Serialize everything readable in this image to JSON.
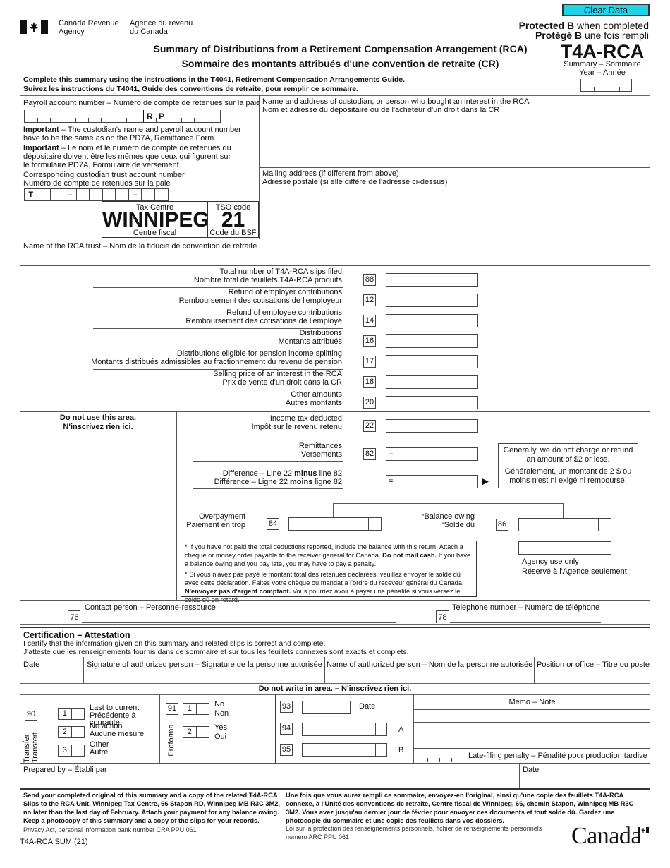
{
  "header": {
    "clear_button": "Clear Data",
    "agency_en_1": "Canada Revenue",
    "agency_en_2": "Agency",
    "agency_fr_1": "Agence du revenu",
    "agency_fr_2": "du Canada",
    "protected_en_bold": "Protected B",
    "protected_en_rest": " when completed",
    "protected_fr_bold": "Protégé B",
    "protected_fr_rest": " une fois rempli",
    "title_en": "Summary of Distributions from a Retirement Compensation Arrangement (RCA)",
    "title_fr": "Sommaire des montants attribués d'une convention de retraite (CR)",
    "form_code": "T4A-RCA",
    "summary_label": "Summary – Sommaire",
    "year_label": "Year – Année",
    "instructions_en": "Complete this summary using the instructions in the T4041, Retirement Compensation Arrangements Guide.",
    "instructions_fr": "Suivez les instructions du T4041, Guide des conventions de retraite, pour remplir ce sommaire."
  },
  "left_panel": {
    "payroll_label": "Payroll account number – Numéro de compte de retenues sur la paie",
    "rp_r": "R",
    "rp_p": "P",
    "important_en_bold": "Important",
    "important_en": " – The custodian's name and payroll account number have to be the same as on the PD7A, Remittance Form.",
    "important_fr_bold": "Important",
    "important_fr": " – Le nom et le numéro de compte de retenues du dépositaire doivent être les mêmes que ceux qui figurent sur le formulaire PD7A, Formulaire de versement.",
    "trust_account_en": "Corresponding custodian trust account number",
    "trust_account_fr": "Numéro de compte de retenues sur la paie",
    "trust_prefix": "T",
    "dash": "–",
    "tax_centre_label": "Tax Centre",
    "tax_centre_value": "WINNIPEG",
    "tax_centre_fr": "Centre fiscal",
    "tso_label": "TSO code",
    "tso_value": "21",
    "tso_fr": "Code du BSF"
  },
  "right_panel": {
    "custodian_en": "Name and address of custodian, or person who bought an interest in the RCA",
    "custodian_fr": "Nom et adresse du dépositaire ou de l'acheteur d'un droit dans la CR",
    "mailing_en": "Mailing address (if different from above)",
    "mailing_fr": "Adresse postale (si elle diffère de l'adresse ci-dessus)"
  },
  "trust_name_label": "Name of the RCA trust – Nom de la fiducie de convention de retraite",
  "lines": [
    {
      "code": "88",
      "en": "Total number of T4A-RCA slips filed",
      "fr": "Nombre total de feuillets T4A-RCA produits"
    },
    {
      "code": "12",
      "en": "Refund of employer contributions",
      "fr": "Remboursement des cotisations de l'employeur"
    },
    {
      "code": "14",
      "en": "Refund of employee contributions",
      "fr": "Remboursement des cotisations de l'employé"
    },
    {
      "code": "16",
      "en": "Distributions",
      "fr": "Montants attribués"
    },
    {
      "code": "17",
      "en": "Distributions eligible for pension income splitting",
      "fr": "Montants distribués admissibles au fractionnement du revenu de pension"
    },
    {
      "code": "18",
      "en": "Selling price of an interest in the RCA",
      "fr": "Prix de vente d'un droit dans la CR"
    },
    {
      "code": "20",
      "en": "Other amounts",
      "fr": "Autres montants"
    }
  ],
  "tax_section": {
    "do_not_use_en": "Do not use this area.",
    "do_not_use_fr": "N'inscrivez rien ici.",
    "income_tax_en": "Income tax deducted",
    "income_tax_fr": "Impôt sur le revenu retenu",
    "code_22": "22",
    "remittances_en": "Remittances",
    "remittances_fr": "Versements",
    "code_82": "82",
    "minus_sign": "–",
    "difference_en_1": "Difference – Line 22 ",
    "difference_en_b": "minus",
    "difference_en_2": " line 82",
    "difference_fr_1": "Différence – Ligne 22 ",
    "difference_fr_b": "moins",
    "difference_fr_2": " ligne 82",
    "equals_sign": "=",
    "arrow": "▶",
    "note_en": "Generally, we do not charge or refund an amount of $2 or less.",
    "note_fr": "Généralement, un montant de 2 $ ou moins n'est ni exigé ni remboursé.",
    "overpayment_en": "Overpayment",
    "overpayment_fr": "Paiement en trop",
    "code_84": "84",
    "asterisk": "*",
    "balance_en": "Balance owing",
    "balance_fr": "Solde dû",
    "code_86": "86",
    "notice_en_1": "* If you have not paid the total deductions reported, include the balance with this return. Attach a cheque or money order payable to the receiver general for Canada. ",
    "notice_en_b": "Do not mail cash.",
    "notice_en_2": " If you have a balance owing and you pay late, you may have to pay a penalty.",
    "notice_fr_1": "* Si vous n'avez pas payé le montant total des retenues déclarées, veuillez envoyer le solde dû avec cette déclaration. Faites votre chèque ou mandat à l'ordre du receveur général du Canada. ",
    "notice_fr_b": "N'envoyez pas d'argent comptant.",
    "notice_fr_2": " Vous pourriez avoir à payer une pénalité si vous versez le solde dû en retard.",
    "agency_use_en": "Agency use only",
    "agency_use_fr": "Réservé à l'Agence seulement",
    "blue": "#1a3fd6"
  },
  "contact": {
    "contact_code": "76",
    "contact_label": "Contact person – Personne-ressource",
    "phone_code": "78",
    "phone_label": "Telephone number – Numéro de téléphone"
  },
  "certification": {
    "title": "Certification – Attestation",
    "text_en": "I certify that the information given on this summary and related slips is correct and complete.",
    "text_fr": "J'atteste que les renseignements fournis dans ce sommaire et sur tous les feuillets connexes sont exacts et complets.",
    "date": "Date",
    "signature": "Signature of authorized person – Signature de la personne autorisée",
    "name": "Name of authorized person – Nom de la personne autorisée",
    "position": "Position or office – Titre ou poste"
  },
  "office_area": {
    "heading": "Do not write in area. – N'inscrivez rien ici.",
    "code_90": "90",
    "transfer_en": "Transfer",
    "transfer_fr": "Transfert",
    "options_90": [
      {
        "n": "1",
        "en": "Last to current",
        "fr": "Précédente à courante"
      },
      {
        "n": "2",
        "en": "No action",
        "fr": "Aucune mesure"
      },
      {
        "n": "3",
        "en": "Other",
        "fr": "Autre"
      }
    ],
    "code_91": "91",
    "proforma": "Proforma",
    "options_91": [
      {
        "n": "1",
        "en": "No",
        "fr": "Non"
      },
      {
        "n": "2",
        "en": "Yes",
        "fr": "Oui"
      }
    ],
    "code_93": "93",
    "date": "Date",
    "code_94": "94",
    "label_a": "A",
    "code_95": "95",
    "label_b": "B",
    "memo": "Memo – Note",
    "late_filing": "Late-filing penalty – Pénalité pour production tardive",
    "prepared_by": "Prepared by – Établi par",
    "prepared_date": "Date"
  },
  "footer": {
    "send_en": "Send your completed original of this summary and a copy of the related T4A-RCA Slips to the RCA Unit, Winnipeg Tax Centre, 66 Stapon RD, Winnipeg MB  R3C 3M2, no later than the last day of February. Attach your payment for any balance owing. Keep a photocopy of this summary and a copy of the slips for your records.",
    "privacy_en": "Privacy Act, personal information bank number CRA PPU 061",
    "form_id": "T4A-RCA SUM (21)",
    "send_fr": "Une fois que vous aurez rempli ce sommaire, envoyez-en l'original, ainsi qu'une copie des feuillets T4A-RCA connexe, à l'Unité des conventions de retraite, Centre fiscal de Winnipeg, 66, chemin Stapon, Winnipeg MB R3C 3M2. Vous avez jusqu'au dernier jour de février pour envoyer ces documents et tout solde dû. Gardez une photocopie du sommaire et une copie des feuillets dans vos dossiers.",
    "privacy_fr_1": "Loi sur la protection des renseignements personnels, fichier de renseignements personnels",
    "privacy_fr_2": "numéro ARC PPU 061",
    "wordmark": "Canada"
  }
}
